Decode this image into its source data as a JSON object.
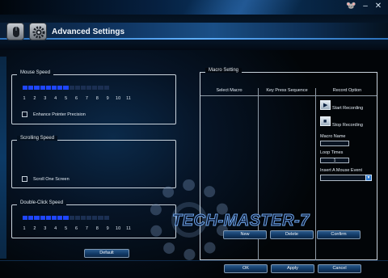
{
  "window": {
    "minimize_glyph": "–",
    "close_glyph": "✕",
    "app_glyph": "🐭"
  },
  "header": {
    "title": "Advanced Settings",
    "icons": [
      "mouse-icon",
      "gear-icon"
    ]
  },
  "mouse_speed": {
    "title": "Mouse Speed",
    "segments_total": 15,
    "segments_on": 8,
    "ticks": [
      "1",
      "2",
      "3",
      "4",
      "5",
      "6",
      "7",
      "8",
      "9",
      "10",
      "11"
    ],
    "checkbox_label": "Enhance Pointer Precision",
    "checked": false
  },
  "scrolling_speed": {
    "title": "Scrolling Speed",
    "checkbox_label": "Scroll One Screen",
    "checked": false
  },
  "double_click_speed": {
    "title": "Double-Click Speed",
    "segments_total": 15,
    "segments_on": 8,
    "ticks": [
      "1",
      "2",
      "3",
      "4",
      "5",
      "6",
      "7",
      "8",
      "9",
      "10",
      "11"
    ]
  },
  "default_button": "Default",
  "macro": {
    "title": "Macro Setting",
    "columns": [
      "Select Macro",
      "Key Press Sequence",
      "Record Option"
    ],
    "start_recording": "Start Recording",
    "stop_recording": "Stop Recording",
    "macro_name_label": "Macro Name",
    "macro_name_value": "",
    "loop_times_label": "Loop Times",
    "loop_times_value": "1",
    "mouse_event_label": "Insert A Mouse Event",
    "mouse_event_value": "",
    "new_button": "New",
    "delete_button": "Delete",
    "confirm_button": "Confirm"
  },
  "footer": {
    "ok": "OK",
    "apply": "Apply",
    "cancel": "Cancel"
  },
  "watermark": {
    "text": "TECH-MASTER-7",
    "sub": "..."
  },
  "colors": {
    "slider_on": "#1f46ff",
    "slider_off": "#1b2f52",
    "accent": "#2f7bd0"
  }
}
